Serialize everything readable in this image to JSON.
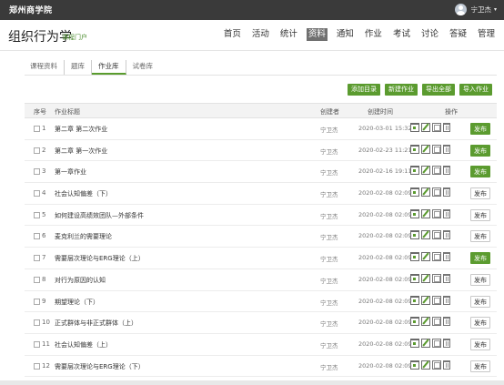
{
  "topbar": {
    "school_name": "郑州商学院",
    "user_name": "宁卫杰",
    "caret": "▾"
  },
  "header": {
    "course_title": "组织行为学",
    "course_subtitle": "课程门户",
    "nav": [
      {
        "label": "首页",
        "active": false
      },
      {
        "label": "活动",
        "active": false
      },
      {
        "label": "统计",
        "active": false
      },
      {
        "label": "资料",
        "active": true
      },
      {
        "label": "通知",
        "active": false
      },
      {
        "label": "作业",
        "active": false
      },
      {
        "label": "考试",
        "active": false
      },
      {
        "label": "讨论",
        "active": false
      },
      {
        "label": "答疑",
        "active": false
      },
      {
        "label": "管理",
        "active": false
      }
    ]
  },
  "tabs": [
    "课程资料",
    "题库",
    "作业库",
    "试卷库"
  ],
  "active_tab": "作业库",
  "actions": [
    "添加目录",
    "新建作业",
    "导出全部",
    "导入作业"
  ],
  "table": {
    "columns": [
      "序号",
      "作业标题",
      "创建者",
      "创建时间",
      "操作"
    ],
    "rows": [
      {
        "num": "1",
        "title": "第二章 第二次作业",
        "creator": "宁卫杰",
        "time": "2020-03-01 15:32",
        "publish": "发布",
        "published": true
      },
      {
        "num": "2",
        "title": "第二章 第一次作业",
        "creator": "宁卫杰",
        "time": "2020-02-23 11:21",
        "publish": "发布",
        "published": true
      },
      {
        "num": "3",
        "title": "第一章作业",
        "creator": "宁卫杰",
        "time": "2020-02-16 19:11",
        "publish": "发布",
        "published": true
      },
      {
        "num": "4",
        "title": "社会认知偏差（下）",
        "creator": "宁卫杰",
        "time": "2020-02-08 02:09",
        "publish": "发布",
        "published": false
      },
      {
        "num": "5",
        "title": "如何建设高绩效团队—外部条件",
        "creator": "宁卫杰",
        "time": "2020-02-08 02:09",
        "publish": "发布",
        "published": false
      },
      {
        "num": "6",
        "title": "麦克利兰的需要理论",
        "creator": "宁卫杰",
        "time": "2020-02-08 02:09",
        "publish": "发布",
        "published": false
      },
      {
        "num": "7",
        "title": "需要层次理论与ERG理论（上）",
        "creator": "宁卫杰",
        "time": "2020-02-08 02:09",
        "publish": "发布",
        "published": true
      },
      {
        "num": "8",
        "title": "对行为原因的认知",
        "creator": "宁卫杰",
        "time": "2020-02-08 02:09",
        "publish": "发布",
        "published": false
      },
      {
        "num": "9",
        "title": "期望理论（下）",
        "creator": "宁卫杰",
        "time": "2020-02-08 02:09",
        "publish": "发布",
        "published": false
      },
      {
        "num": "10",
        "title": "正式群体与非正式群体（上）",
        "creator": "宁卫杰",
        "time": "2020-02-08 02:09",
        "publish": "发布",
        "published": false
      },
      {
        "num": "11",
        "title": "社会认知偏差（上）",
        "creator": "宁卫杰",
        "time": "2020-02-08 02:09",
        "publish": "发布",
        "published": false
      },
      {
        "num": "12",
        "title": "需要层次理论与ERG理论（下）",
        "creator": "宁卫杰",
        "time": "2020-02-08 02:09",
        "publish": "发布",
        "published": false
      }
    ]
  }
}
